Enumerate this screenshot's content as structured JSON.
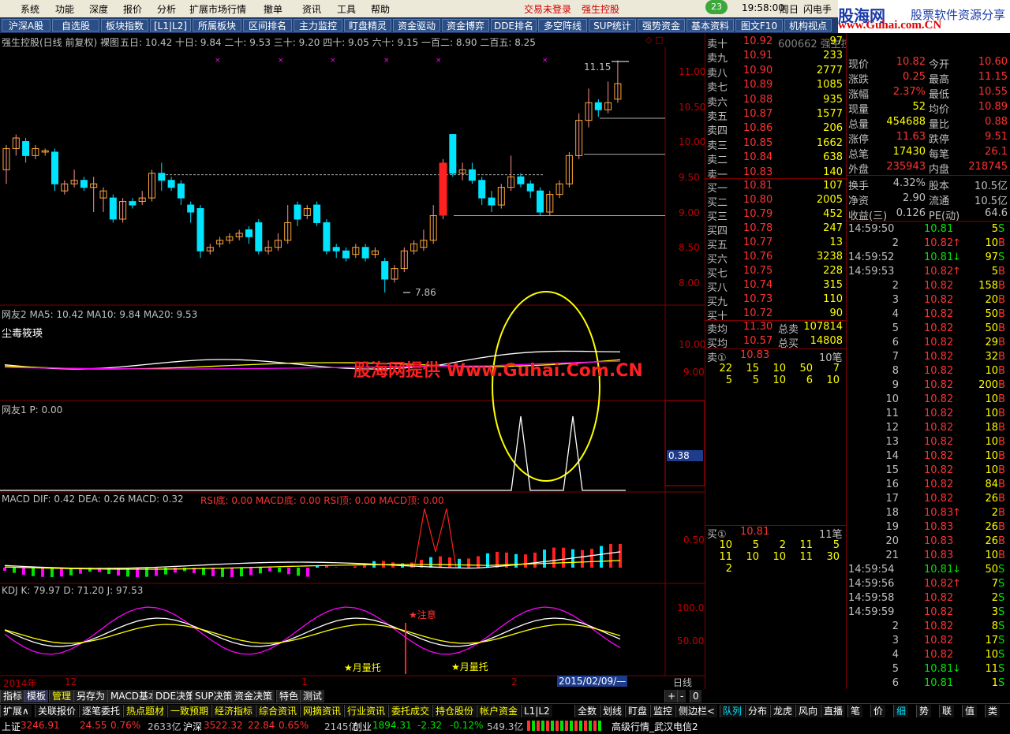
{
  "menu": {
    "items": [
      "系统",
      "功能",
      "深度",
      "报价",
      "分析",
      "扩展市场行情",
      "撤单",
      "资讯",
      "工具",
      "帮助"
    ],
    "login_status": "交易未登录",
    "stock_name": "强生控股",
    "badge": "23",
    "clock": "19:58:00",
    "weekday": "周日",
    "flash": "闪电手"
  },
  "tabs": [
    "沪深A股",
    "自选股",
    "板块指数",
    "[L1|L2]",
    "所属板块",
    "区间排名",
    "主力监控",
    "盯盘精灵",
    "资金驱动",
    "资金博弈",
    "DDE排名",
    "多空阵线",
    "SUP统计",
    "强势资金",
    "基本资料",
    "图文F10",
    "机构视点"
  ],
  "logo": {
    "cn": "股海网",
    "slogan": "股票软件资源分享",
    "url": "www.Guhai.com.CN"
  },
  "chart_header": {
    "title": "强生控股(日线 前复权) 裸图",
    "ma": "五日: 10.42  十日: 9.84  二十: 9.53  三十: 9.20  四十: 9.05  六十: 9.15  一百二: 8.90  二百五: 8.25"
  },
  "price_axis": [
    "11.00",
    "10.50",
    "10.00",
    "9.50",
    "9.00",
    "8.50",
    "8.00"
  ],
  "price_labels": {
    "high": "11.15",
    "low": "7.86"
  },
  "panel2": {
    "header": "网友2  MA5: 10.42  MA10: 9.84  MA20: 9.53",
    "sub": "尘毒筱瑛",
    "axis": [
      "10.00",
      "9.00"
    ]
  },
  "watermark": "股海网提供 Www.Guhai.Com.CN",
  "panel3": {
    "header": "网友1  P: 0.00",
    "value": "0.38"
  },
  "macd": {
    "header_a": "MACD  DIF: 0.42  DEA: 0.26  MACD: 0.32",
    "header_b": "RSI底: 0.00  MACD底: 0.00  RSI顶: 0.00  MACD顶: 0.00",
    "axis": "0.50"
  },
  "kdj": {
    "header": "KDJ  K: 79.97  D: 71.20  J: 97.53",
    "axis": [
      "100.0",
      "50.00"
    ],
    "note_attention": "★注意",
    "note_moon1": "★月量托",
    "note_moon2": "★月量托"
  },
  "timeline": {
    "year": "2014年",
    "m12": "12",
    "m1": "1",
    "m2": "2",
    "date": "2015/02/09/—",
    "period": "日线"
  },
  "orderbook": {
    "code": "600662 强生控股",
    "sells": [
      [
        "卖十",
        "10.92",
        "97"
      ],
      [
        "卖九",
        "10.91",
        "233"
      ],
      [
        "卖八",
        "10.90",
        "2777"
      ],
      [
        "卖七",
        "10.89",
        "1085"
      ],
      [
        "卖六",
        "10.88",
        "935"
      ],
      [
        "卖五",
        "10.87",
        "1577"
      ],
      [
        "卖四",
        "10.86",
        "206"
      ],
      [
        "卖三",
        "10.85",
        "1662"
      ],
      [
        "卖二",
        "10.84",
        "638"
      ],
      [
        "卖一",
        "10.83",
        "140"
      ]
    ],
    "buys": [
      [
        "买一",
        "10.81",
        "107"
      ],
      [
        "买二",
        "10.80",
        "2005"
      ],
      [
        "买三",
        "10.79",
        "452"
      ],
      [
        "买四",
        "10.78",
        "247"
      ],
      [
        "买五",
        "10.77",
        "13"
      ],
      [
        "买六",
        "10.76",
        "3238"
      ],
      [
        "买七",
        "10.75",
        "228"
      ],
      [
        "买八",
        "10.74",
        "315"
      ],
      [
        "买九",
        "10.73",
        "110"
      ],
      [
        "买十",
        "10.72",
        "90"
      ]
    ],
    "avg": [
      [
        "卖均",
        "11.30",
        "总卖",
        "107814"
      ],
      [
        "买均",
        "10.57",
        "总买",
        "14808"
      ]
    ],
    "sell1": {
      "label": "卖①",
      "price": "10.83",
      "count": "10笔",
      "row1": [
        "22",
        "15",
        "10",
        "50",
        "7"
      ],
      "row2": [
        "5",
        "5",
        "10",
        "6",
        "10"
      ]
    },
    "buy1": {
      "label": "买①",
      "price": "10.81",
      "count": "11笔",
      "row1": [
        "10",
        "5",
        "2",
        "11",
        "5"
      ],
      "row2": [
        "11",
        "10",
        "10",
        "11",
        "30"
      ],
      "row3": [
        "2"
      ]
    }
  },
  "quote": {
    "rows": [
      [
        "现价",
        "10.82",
        "今开",
        "10.60"
      ],
      [
        "涨跌",
        "0.25",
        "最高",
        "11.15"
      ],
      [
        "涨幅",
        "2.37%",
        "最低",
        "10.55"
      ],
      [
        "现量",
        "52",
        "均价",
        "10.89"
      ],
      [
        "总量",
        "454688",
        "量比",
        "0.88"
      ],
      [
        "涨停",
        "11.63",
        "跌停",
        "9.51"
      ],
      [
        "总笔",
        "17430",
        "每笔",
        "26.1"
      ],
      [
        "外盘",
        "235943",
        "内盘",
        "218745"
      ]
    ],
    "rows2": [
      [
        "换手",
        "4.32%",
        "股本",
        "10.5亿"
      ],
      [
        "净资",
        "2.90",
        "流通",
        "10.5亿"
      ],
      [
        "收益(三)",
        "0.126",
        "PE(动)",
        "64.6"
      ]
    ]
  },
  "ticks": [
    [
      "14:59:50",
      "10.81",
      "",
      "5",
      "S"
    ],
    [
      "2",
      "10.82",
      "↑",
      "10",
      "B"
    ],
    [
      "14:59:52",
      "10.81",
      "↓",
      "97",
      "S"
    ],
    [
      "14:59:53",
      "10.82",
      "↑",
      "5",
      "B"
    ],
    [
      "2",
      "10.82",
      "",
      "158",
      "B"
    ],
    [
      "3",
      "10.82",
      "",
      "20",
      "B"
    ],
    [
      "4",
      "10.82",
      "",
      "50",
      "B"
    ],
    [
      "5",
      "10.82",
      "",
      "50",
      "B"
    ],
    [
      "6",
      "10.82",
      "",
      "29",
      "B"
    ],
    [
      "7",
      "10.82",
      "",
      "32",
      "B"
    ],
    [
      "8",
      "10.82",
      "",
      "10",
      "B"
    ],
    [
      "9",
      "10.82",
      "",
      "200",
      "B"
    ],
    [
      "10",
      "10.82",
      "",
      "10",
      "B"
    ],
    [
      "11",
      "10.82",
      "",
      "10",
      "B"
    ],
    [
      "12",
      "10.82",
      "",
      "18",
      "B"
    ],
    [
      "13",
      "10.82",
      "",
      "10",
      "B"
    ],
    [
      "14",
      "10.82",
      "",
      "10",
      "B"
    ],
    [
      "15",
      "10.82",
      "",
      "10",
      "B"
    ],
    [
      "16",
      "10.82",
      "",
      "84",
      "B"
    ],
    [
      "17",
      "10.82",
      "",
      "26",
      "B"
    ],
    [
      "18",
      "10.83",
      "↑",
      "2",
      "B"
    ],
    [
      "19",
      "10.83",
      "",
      "26",
      "B"
    ],
    [
      "20",
      "10.83",
      "",
      "26",
      "B"
    ],
    [
      "21",
      "10.83",
      "",
      "10",
      "B"
    ],
    [
      "14:59:54",
      "10.81",
      "↓",
      "50",
      "S"
    ],
    [
      "14:59:56",
      "10.82",
      "↑",
      "7",
      "S"
    ],
    [
      "14:59:58",
      "10.82",
      "",
      "2",
      "S"
    ],
    [
      "14:59:59",
      "10.82",
      "",
      "3",
      "S"
    ],
    [
      "2",
      "10.82",
      "",
      "8",
      "S"
    ],
    [
      "3",
      "10.82",
      "",
      "17",
      "S"
    ],
    [
      "4",
      "10.82",
      "",
      "10",
      "S"
    ],
    [
      "5",
      "10.81",
      "↓",
      "11",
      "S"
    ],
    [
      "6",
      "10.81",
      "",
      "1",
      "S"
    ]
  ],
  "bottom_tabs": [
    "指标",
    "模板",
    "管理",
    "另存为",
    "MACD基本",
    "DDE决策",
    "SUP决策",
    "资金决策",
    "特色",
    "测试"
  ],
  "bottom_nav": [
    "+",
    "-",
    "0"
  ],
  "bottom_row2": [
    "扩展∧",
    "关联报价",
    "逐笔委托",
    "热点题材",
    "一致预期",
    "经济指标",
    "综合资讯",
    "网摘资讯",
    "行业资讯",
    "委托成交",
    "持仓股份",
    "帐户资金",
    "L1|L2",
    "全数",
    "划线",
    "盯盘",
    "监控",
    "侧边栏<",
    "队列",
    "分布",
    "龙虎",
    "风向",
    "直播"
  ],
  "right_tabs": [
    "笔",
    "价",
    "细",
    "势",
    "联",
    "值",
    "类"
  ],
  "status": {
    "sh_label": "上证",
    "sh": "3246.91",
    "sh_chg": "24.55",
    "sh_pct": "0.76%",
    "sh_vol": "2633亿",
    "hs_label": "沪深",
    "hs": "3522.32",
    "hs_chg": "22.84",
    "hs_pct": "0.65%",
    "hs_vol": "2145亿",
    "cy_label": "创业",
    "cy": "1894.31",
    "cy_chg": "-2.32",
    "cy_pct": "-0.12%",
    "cy_vol": "549.3亿",
    "server": "高级行情_武汉电信2"
  },
  "colors": {
    "up": "#ff3232",
    "down": "#00e4ff",
    "yellow": "#ffff00",
    "magenta": "#ff00ff"
  }
}
